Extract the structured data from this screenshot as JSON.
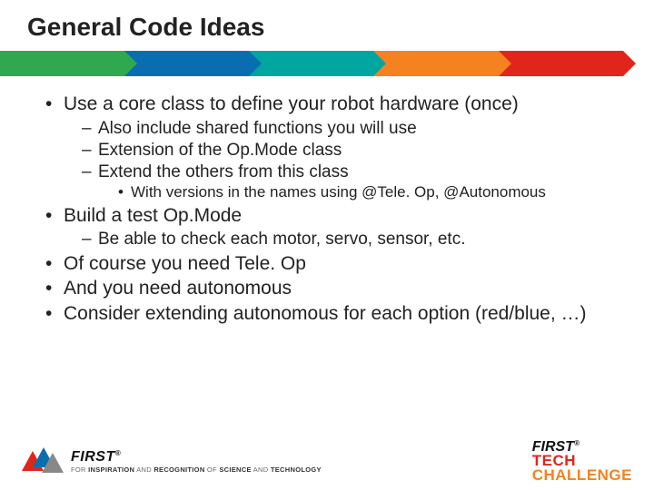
{
  "title": "General Code Ideas",
  "bullets": {
    "b1": "Use a core class to define your robot hardware (once)",
    "b1_s1": "Also include shared functions you will use",
    "b1_s2": "Extension of the Op.Mode class",
    "b1_s3": "Extend the others from this class",
    "b1_s3_ss1": "With versions in the names using @Tele. Op, @Autonomous",
    "b2": "Build a test Op.Mode",
    "b2_s1": "Be able to check each motor, servo, sensor, etc.",
    "b3": "Of course you need Tele. Op",
    "b4": "And you need autonomous",
    "b5": "Consider extending autonomous for each option (red/blue, …)"
  },
  "footer": {
    "first_brand": "FIRST",
    "reg": "®",
    "tagline_prefix": "FOR ",
    "tagline_words": "INSPIRATION",
    "tagline_and": " AND ",
    "tagline_words2": "RECOGNITION",
    "tagline_of": " OF ",
    "tagline_words3": "SCIENCE",
    "tagline_and2": " AND ",
    "tagline_words4": "TECHNOLOGY",
    "tech": "TECH",
    "challenge": "CHALLENGE"
  }
}
